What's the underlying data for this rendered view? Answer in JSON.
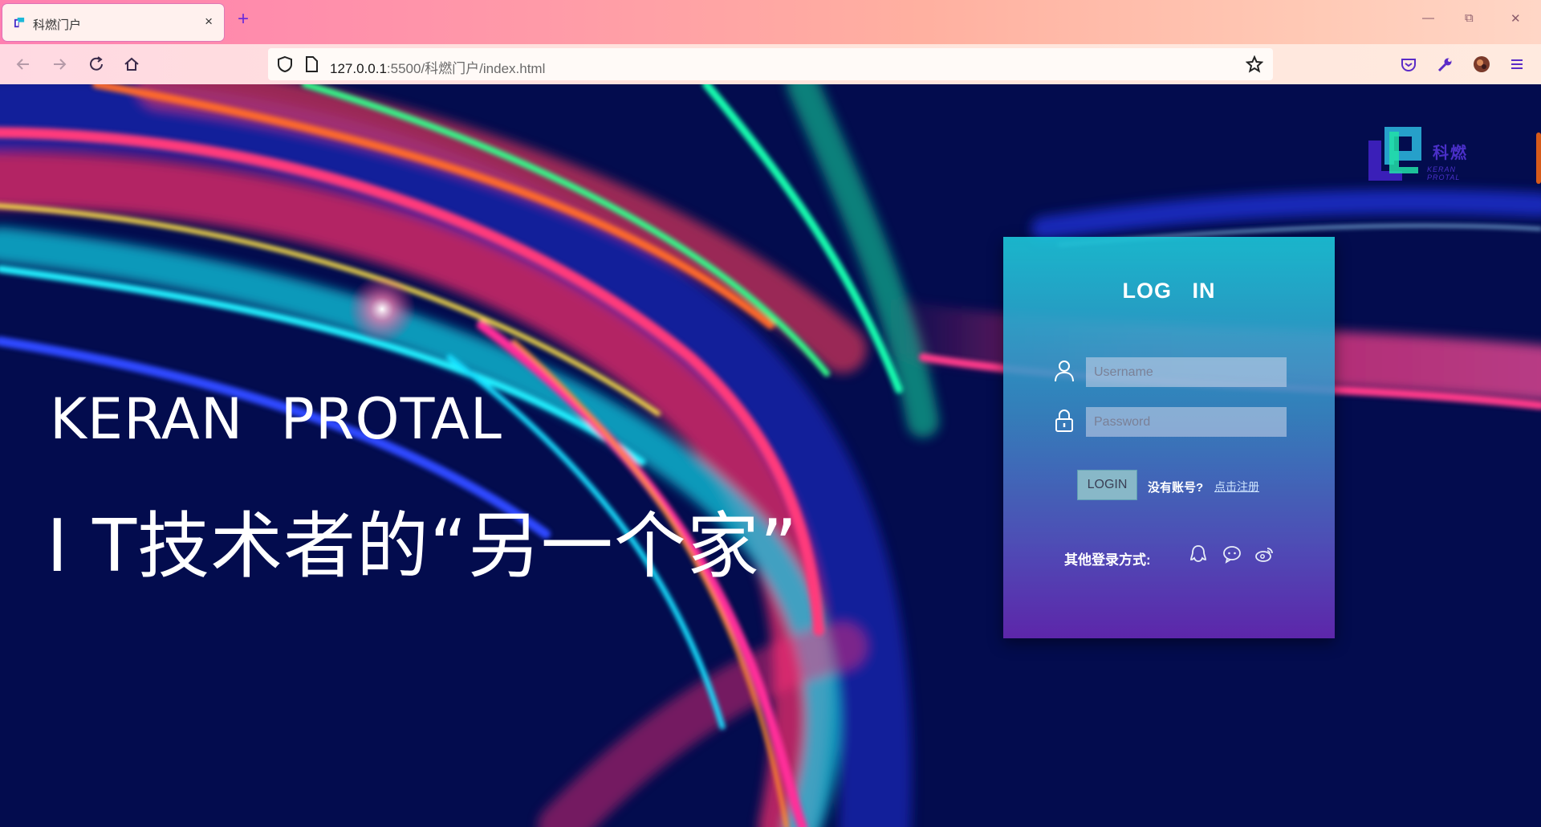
{
  "browser": {
    "tab_title": "科燃门户",
    "tab_close": "×",
    "new_tab": "+",
    "window_controls": {
      "minimize": "—",
      "restore": "⧉",
      "close": "✕"
    },
    "url_host": "127.0.0.1",
    "url_rest": ":5500/科燃门户/index.html",
    "icons": [
      "back-icon",
      "forward-icon",
      "reload-icon",
      "home-icon",
      "shield-icon",
      "page-icon",
      "bookmark-star-icon",
      "pocket-icon",
      "wrench-icon",
      "avatar",
      "menu-icon"
    ]
  },
  "page": {
    "logo": {
      "cn": "科燃",
      "en": "KERAN PROTAL"
    },
    "hero": {
      "title_en": "KERAN  PROTAL",
      "subtitle_cn": "I T技术者的“另一个家”"
    },
    "login": {
      "title": "LOG   IN",
      "username_placeholder": "Username",
      "password_placeholder": "Password",
      "login_button": "LOGIN",
      "no_account": "没有账号?",
      "register_link": "点击注册",
      "other_login": "其他登录方式:",
      "social": [
        "qq-icon",
        "wechat-icon",
        "weibo-icon"
      ]
    },
    "colors": {
      "background": "#030c4e",
      "panel_top": "#1cc4d6",
      "panel_bottom": "#6228af",
      "logo": "#4a2fc8"
    }
  }
}
